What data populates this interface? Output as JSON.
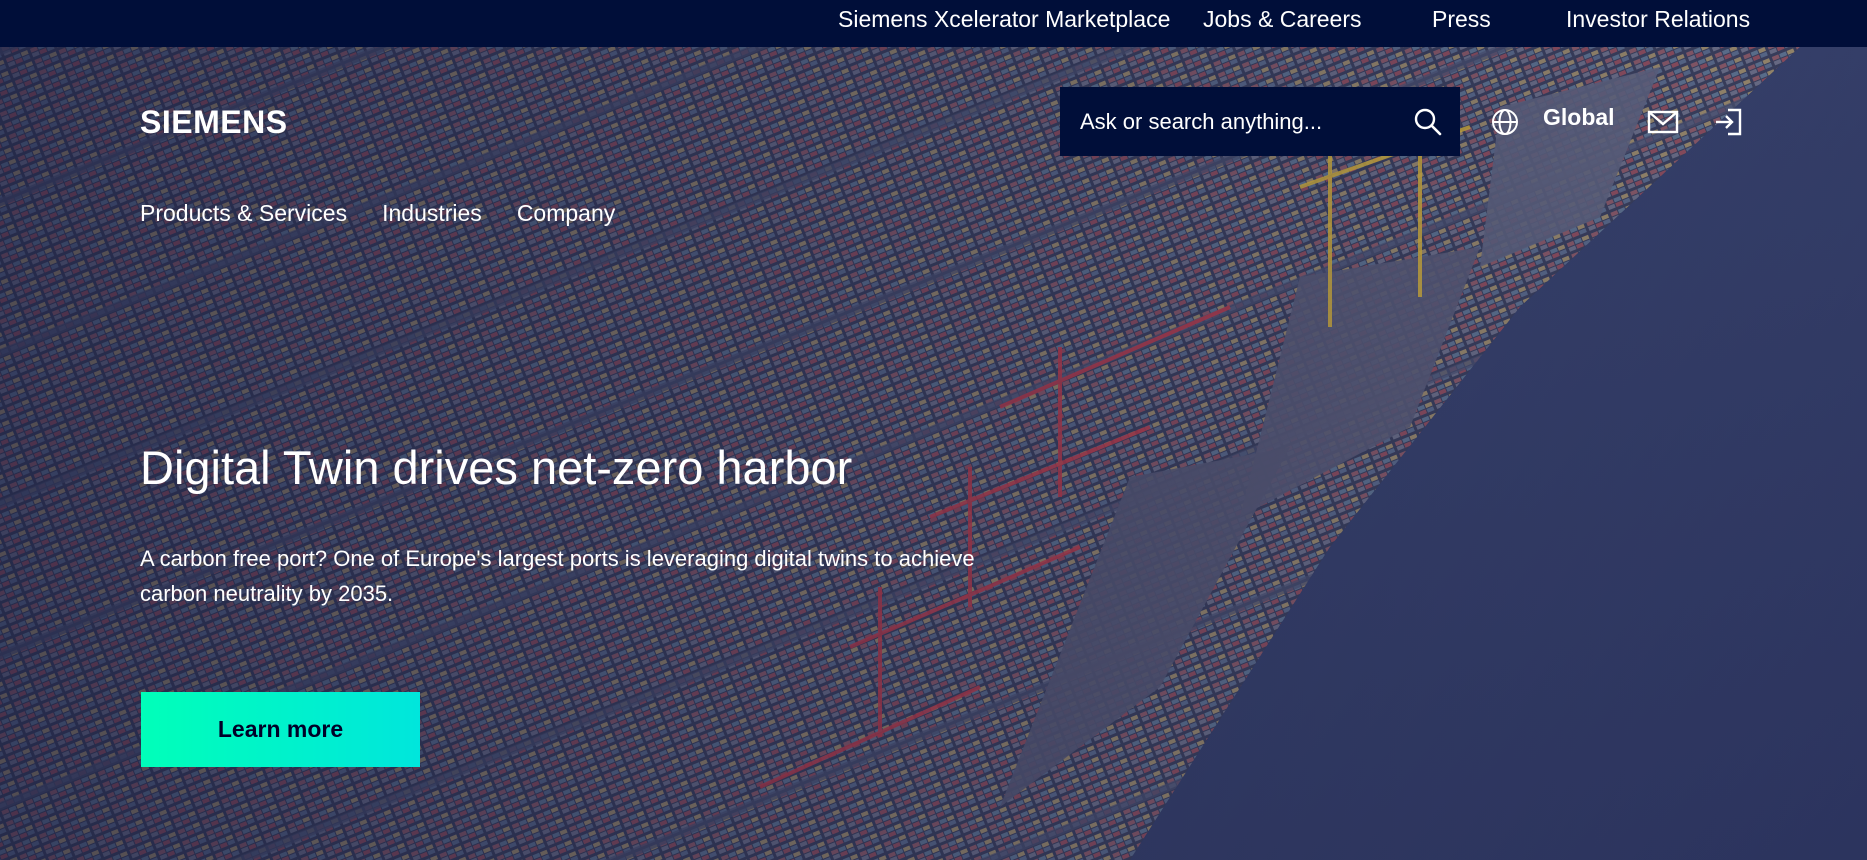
{
  "topbar": {
    "links": [
      {
        "label": "Siemens Xcelerator Marketplace"
      },
      {
        "label": "Jobs & Careers"
      },
      {
        "label": "Press"
      },
      {
        "label": "Investor Relations"
      }
    ]
  },
  "header": {
    "logo_text": "SIEMENS",
    "search": {
      "placeholder": "Ask or search anything...",
      "value": ""
    },
    "region_label": "Global",
    "icons": [
      "search-icon",
      "globe-icon",
      "mail-icon",
      "login-icon"
    ]
  },
  "nav": {
    "items": [
      {
        "label": "Products & Services"
      },
      {
        "label": "Industries"
      },
      {
        "label": "Company"
      }
    ]
  },
  "hero": {
    "headline": "Digital Twin drives net-zero harbor",
    "description": "A carbon free port? One of Europe's largest ports is leveraging digital twins to achieve carbon neutrality by 2035.",
    "cta_label": "Learn more"
  },
  "colors": {
    "topbar_bg": "#000e39",
    "search_bg": "#000e39",
    "cta_gradient_start": "#00ffb9",
    "cta_gradient_end": "#00e6dc",
    "cta_text": "#000028",
    "text": "#ffffff"
  }
}
